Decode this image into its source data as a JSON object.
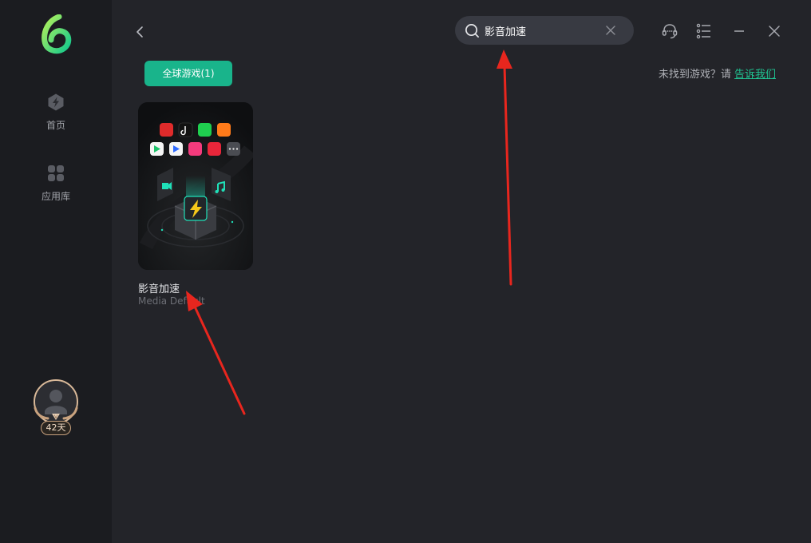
{
  "sidebar": {
    "nav": [
      {
        "label": "首页",
        "icon": "home-bolt-icon"
      },
      {
        "label": "应用库",
        "icon": "app-grid-icon"
      }
    ],
    "user": {
      "days_label": "42天",
      "badge_icon": "crown-badge-icon"
    }
  },
  "search": {
    "value": "影音加速",
    "placeholder": ""
  },
  "tabs": [
    {
      "label": "全球游戏(1)",
      "active": true
    }
  ],
  "not_found": {
    "prefix": "未找到游戏？请 ",
    "link": "告诉我们"
  },
  "games": [
    {
      "title": "影音加速",
      "subtitle": "Media Default"
    }
  ],
  "colors": {
    "accent": "#19b48b",
    "link": "#20c492",
    "background": "#232429",
    "sidebar": "#1b1c20",
    "annotation": "#e8261e"
  },
  "window_controls": [
    "support-icon",
    "menu-list-icon",
    "minimize-icon",
    "close-icon"
  ]
}
